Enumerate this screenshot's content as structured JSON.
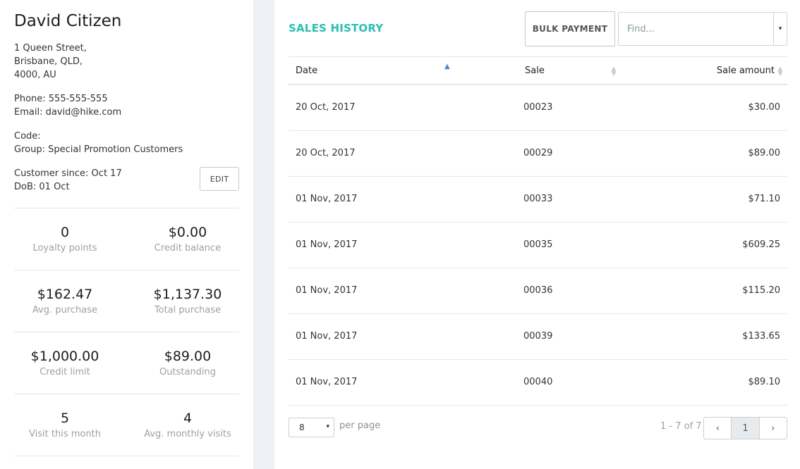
{
  "customer": {
    "name": "David Citizen",
    "address": [
      "1 Queen Street,",
      "Brisbane, QLD,",
      "4000, AU"
    ],
    "phone": "Phone: 555-555-555",
    "email": "Email: david@hike.com",
    "code": "Code:",
    "group": "Group: Special Promotion Customers",
    "since": "Customer since: Oct 17",
    "dob": "DoB: 01 Oct",
    "edit_label": "EDIT"
  },
  "stats": [
    {
      "value": "0",
      "label": "Loyalty points"
    },
    {
      "value": "$0.00",
      "label": "Credit balance"
    },
    {
      "value": "$162.47",
      "label": "Avg. purchase"
    },
    {
      "value": "$1,137.30",
      "label": "Total purchase"
    },
    {
      "value": "$1,000.00",
      "label": "Credit limit"
    },
    {
      "value": "$89.00",
      "label": "Outstanding"
    },
    {
      "value": "5",
      "label": "Visit this month"
    },
    {
      "value": "4",
      "label": "Avg. monthly visits"
    }
  ],
  "sales_history": {
    "title": "SALES HISTORY",
    "bulk_payment_label": "BULK PAYMENT",
    "find_placeholder": "Find...",
    "columns": [
      "Date",
      "Sale",
      "Sale amount"
    ],
    "rows": [
      {
        "date": "20 Oct, 2017",
        "sale": "00023",
        "amount": "$30.00"
      },
      {
        "date": "20 Oct, 2017",
        "sale": "00029",
        "amount": "$89.00"
      },
      {
        "date": "01 Nov, 2017",
        "sale": "00033",
        "amount": "$71.10"
      },
      {
        "date": "01 Nov, 2017",
        "sale": "00035",
        "amount": "$609.25"
      },
      {
        "date": "01 Nov, 2017",
        "sale": "00036",
        "amount": "$115.20"
      },
      {
        "date": "01 Nov, 2017",
        "sale": "00039",
        "amount": "$133.65"
      },
      {
        "date": "01 Nov, 2017",
        "sale": "00040",
        "amount": "$89.10"
      }
    ],
    "per_page_value": "8",
    "per_page_label": "per page",
    "range_text": "1 - 7 of 7",
    "current_page": "1"
  },
  "icons": {
    "caret_down": "▾",
    "sort_up": "▲",
    "sort_both": "▲▼",
    "prev": "‹",
    "next": "›"
  },
  "colors": {
    "accent": "#2bbfb1",
    "sort_active": "#5c7fd6",
    "band": "#edf0f4"
  }
}
